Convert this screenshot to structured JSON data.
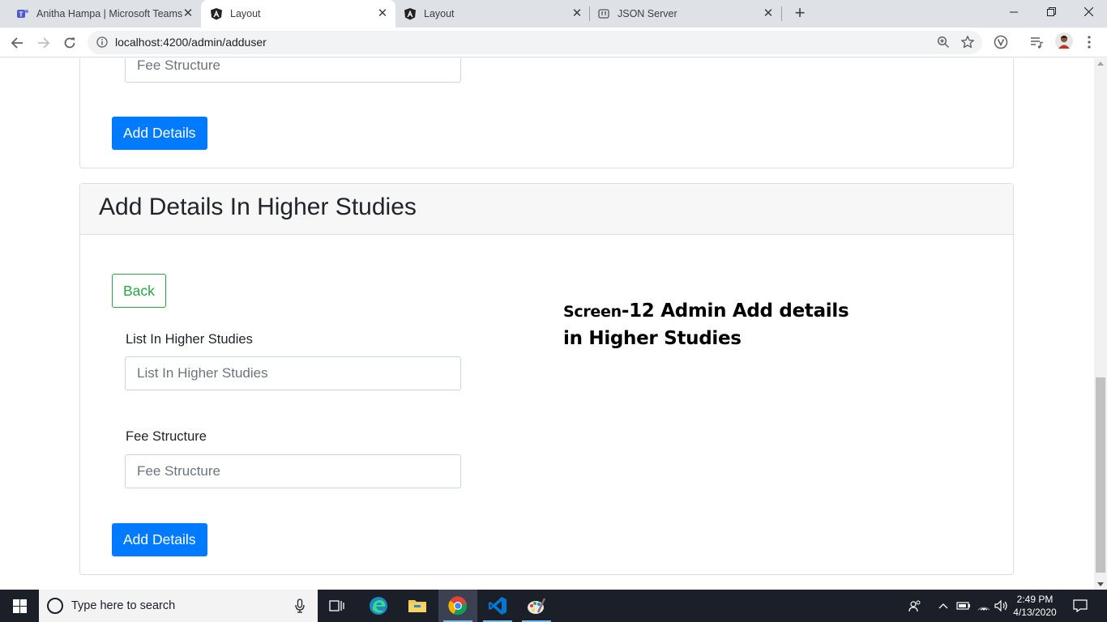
{
  "browser": {
    "tabs": [
      {
        "title": "Anitha Hampa | Microsoft Teams",
        "icon": "teams-icon",
        "active": false
      },
      {
        "title": "Layout",
        "icon": "angular-icon",
        "active": true
      },
      {
        "title": "Layout",
        "icon": "angular-icon",
        "active": false
      },
      {
        "title": "JSON Server",
        "icon": "json-server-icon",
        "active": false
      }
    ],
    "new_tab_label": "+",
    "url": "localhost:4200/admin/adduser"
  },
  "page": {
    "top_section": {
      "fee_placeholder": "Fee Structure",
      "add_button": "Add Details"
    },
    "higher_studies": {
      "header": "Add Details In Higher Studies",
      "back_button": "Back",
      "list_label": "List In Higher Studies",
      "list_placeholder": "List In Higher Studies",
      "fee_label": "Fee Structure",
      "fee_placeholder": "Fee Structure",
      "add_button": "Add Details"
    },
    "annotation": {
      "prefix": "Screen",
      "line1_rest": "-12 Admin Add details",
      "line2": "in Higher Studies"
    }
  },
  "taskbar": {
    "search_placeholder": "Type here to search",
    "time": "2:49 PM",
    "date": "4/13/2020",
    "apps": [
      "task-view-icon",
      "edge-icon",
      "file-explorer-icon",
      "chrome-icon",
      "vscode-icon",
      "paint-icon"
    ]
  },
  "colors": {
    "primary": "#007bff",
    "success": "#28a745",
    "taskbar": "#1b1f27"
  }
}
